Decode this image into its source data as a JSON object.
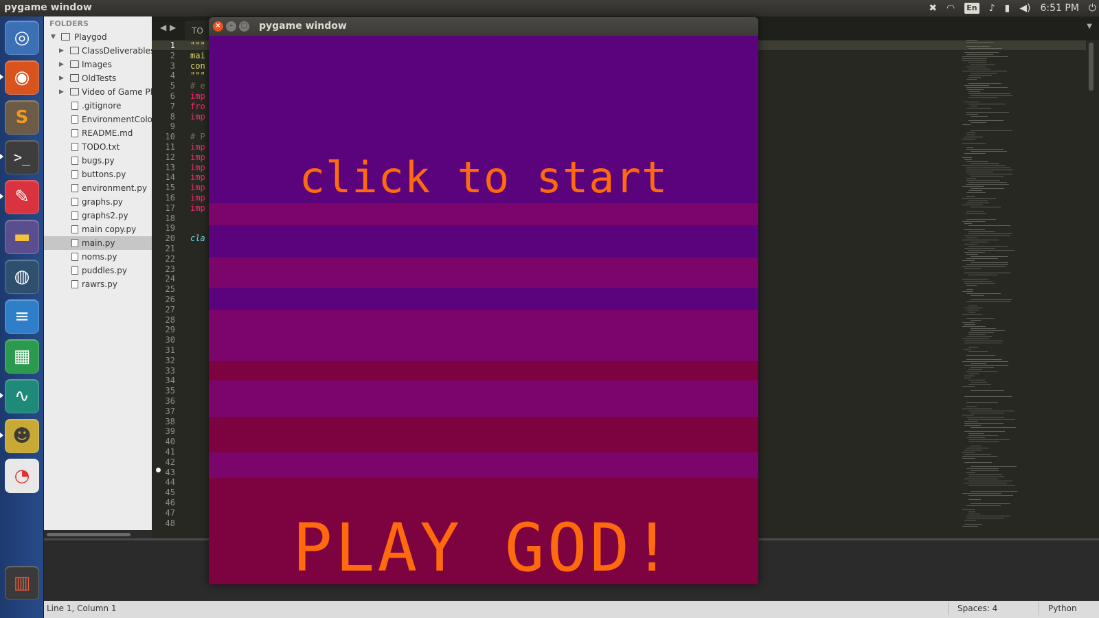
{
  "top_panel": {
    "title": "pygame window",
    "lang": "En",
    "clock": "6:51 PM"
  },
  "launcher": {
    "items": [
      "ubuntu-dash",
      "firefox",
      "sublime-text",
      "terminal",
      "notes",
      "files",
      "screenshot",
      "text-editor",
      "spreadsheet",
      "system-monitor",
      "game",
      "disk-usage",
      "trash"
    ]
  },
  "sidebar": {
    "header": "FOLDERS",
    "root": "Playgod",
    "folders": [
      "ClassDeliverables",
      "Images",
      "OldTests",
      "Video of Game Pla"
    ],
    "files": [
      ".gitignore",
      "EnvironmentColor",
      "README.md",
      "TODO.txt",
      "bugs.py",
      "buttons.py",
      "environment.py",
      "graphs.py",
      "graphs2.py",
      "main copy.py",
      "main.py",
      "noms.py",
      "puddles.py",
      "rawrs.py"
    ],
    "selected": "main.py"
  },
  "editor": {
    "tab": "TO",
    "line_numbers": [
      "1",
      "2",
      "3",
      "4",
      "5",
      "6",
      "7",
      "8",
      "9",
      "10",
      "11",
      "12",
      "13",
      "14",
      "15",
      "16",
      "17",
      "18",
      "19",
      "20",
      "21",
      "22",
      "23",
      "24",
      "25",
      "26",
      "27",
      "28",
      "29",
      "30",
      "31",
      "32",
      "33",
      "34",
      "35",
      "36",
      "37",
      "38",
      "39",
      "40",
      "41",
      "42",
      "43",
      "44",
      "45",
      "46",
      "47",
      "48"
    ],
    "code": {
      "l1": "\"\"\"",
      "l2": "mai",
      "l3": "con",
      "l4": "\"\"\"",
      "l5": "# e",
      "l6": "imp",
      "l7": "fro",
      "l8": "imp",
      "l10": "# P",
      "l11": "imp",
      "l12": "imp",
      "l13": "imp",
      "l14": "imp",
      "l15": "imp",
      "l16": "imp",
      "l17": "imp",
      "l20": "cla"
    }
  },
  "statusbar": {
    "position": "Line 1, Column 1",
    "spaces": "Spaces: 4",
    "syntax": "Python"
  },
  "pygame": {
    "window_title": "pygame window",
    "start_text": "click to start",
    "play_text": "PLAY GOD!"
  },
  "colors": {
    "band_purple": "#5a037d",
    "band_magenta": "#7a0568",
    "band_crimson": "#7c033f",
    "text_orange": "#ff6a0f"
  }
}
